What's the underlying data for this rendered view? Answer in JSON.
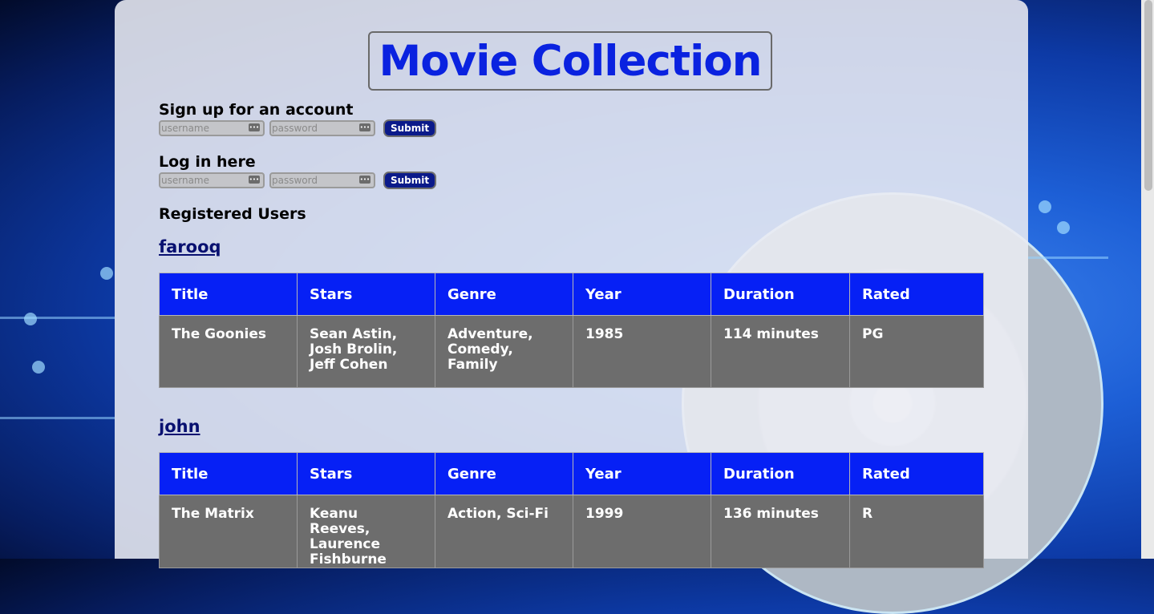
{
  "page": {
    "title": "Movie Collection"
  },
  "signup": {
    "heading": "Sign up for an account",
    "username_placeholder": "username",
    "password_placeholder": "password",
    "submit_label": "Submit"
  },
  "login": {
    "heading": "Log in here",
    "username_placeholder": "username",
    "password_placeholder": "password",
    "submit_label": "Submit"
  },
  "users_heading": "Registered Users",
  "table_headers": [
    "Title",
    "Stars",
    "Genre",
    "Year",
    "Duration",
    "Rated"
  ],
  "users": [
    {
      "name": "farooq",
      "movies": [
        {
          "title": "The Goonies",
          "stars": "Sean Astin, Josh Brolin, Jeff Cohen",
          "genre": "Adventure, Comedy, Family",
          "year": "1985",
          "duration": "114 minutes",
          "rated": "PG"
        }
      ]
    },
    {
      "name": "john",
      "movies": [
        {
          "title": "The Matrix",
          "stars": "Keanu Reeves, Laurence Fishburne",
          "genre": "Action, Sci-Fi",
          "year": "1999",
          "duration": "136 minutes",
          "rated": "R"
        }
      ]
    }
  ],
  "colors": {
    "title": "#0a22e0",
    "header_bg": "#0620f5",
    "cell_bg": "#6d6d6d",
    "button_bg": "#0b1a8a",
    "link": "#081070"
  },
  "icons": {
    "password_key": "key-icon"
  }
}
